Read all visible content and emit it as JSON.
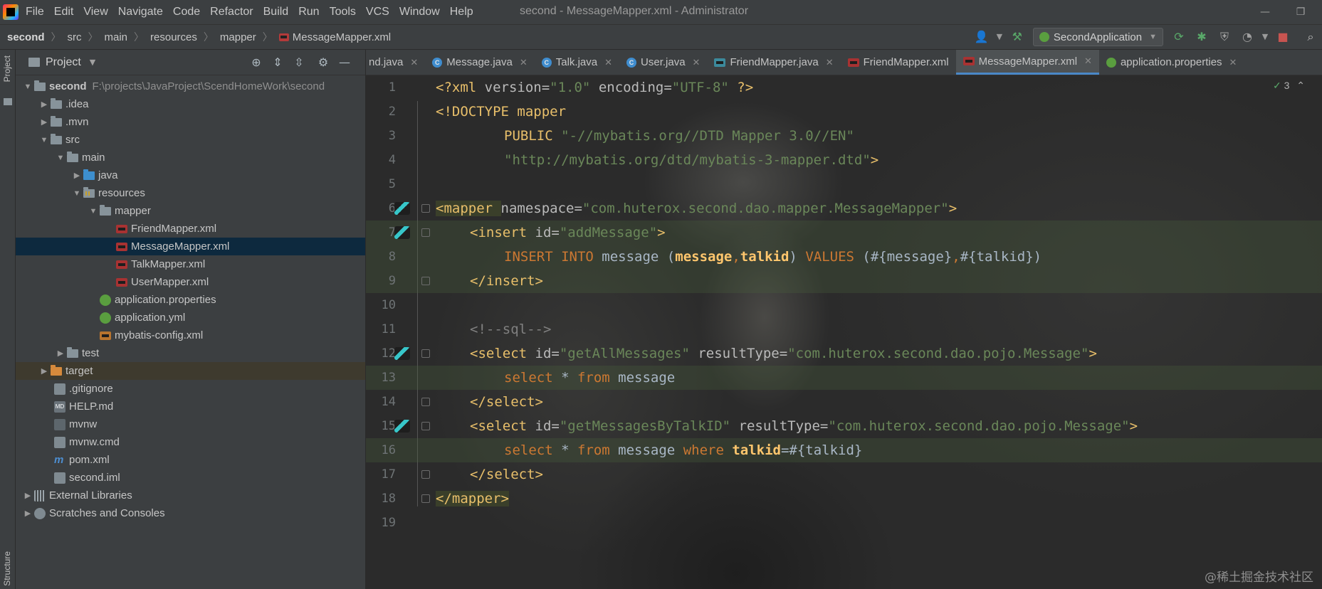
{
  "menu": [
    "File",
    "Edit",
    "View",
    "Navigate",
    "Code",
    "Refactor",
    "Build",
    "Run",
    "Tools",
    "VCS",
    "Window",
    "Help"
  ],
  "window_title": "second - MessageMapper.xml - Administrator",
  "breadcrumb": [
    "second",
    "src",
    "main",
    "resources",
    "mapper",
    "MessageMapper.xml"
  ],
  "run_config": "SecondApplication",
  "left_strip": {
    "project": "Project",
    "structure": "Structure"
  },
  "project_panel": {
    "title": "Project",
    "tree": [
      {
        "label": "second",
        "path": "F:\\projects\\JavaProject\\ScendHomeWork\\second"
      },
      {
        "label": ".idea"
      },
      {
        "label": ".mvn"
      },
      {
        "label": "src"
      },
      {
        "label": "main"
      },
      {
        "label": "java"
      },
      {
        "label": "resources"
      },
      {
        "label": "mapper"
      },
      {
        "label": "FriendMapper.xml"
      },
      {
        "label": "MessageMapper.xml"
      },
      {
        "label": "TalkMapper.xml"
      },
      {
        "label": "UserMapper.xml"
      },
      {
        "label": "application.properties"
      },
      {
        "label": "application.yml"
      },
      {
        "label": "mybatis-config.xml"
      },
      {
        "label": "test"
      },
      {
        "label": "target"
      },
      {
        "label": ".gitignore"
      },
      {
        "label": "HELP.md"
      },
      {
        "label": "mvnw"
      },
      {
        "label": "mvnw.cmd"
      },
      {
        "label": "pom.xml"
      },
      {
        "label": "second.iml"
      },
      {
        "label": "External Libraries"
      },
      {
        "label": "Scratches and Consoles"
      }
    ]
  },
  "tabs": [
    {
      "label": "nd.java"
    },
    {
      "label": "Message.java"
    },
    {
      "label": "Talk.java"
    },
    {
      "label": "User.java"
    },
    {
      "label": "FriendMapper.java"
    },
    {
      "label": "FriendMapper.xml"
    },
    {
      "label": "MessageMapper.xml"
    },
    {
      "label": "application.properties"
    }
  ],
  "inspection_count": "3",
  "watermark": "@稀土掘金技术社区",
  "line_numbers": [
    "1",
    "2",
    "3",
    "4",
    "5",
    "6",
    "7",
    "8",
    "9",
    "10",
    "11",
    "12",
    "13",
    "14",
    "15",
    "16",
    "17",
    "18",
    "19"
  ],
  "code": {
    "l1": {
      "a": "<?xml ",
      "b": "version",
      "c": "=",
      "d": "\"1.0\"",
      "e": " encoding",
      "f": "=",
      "g": "\"UTF-8\"",
      "h": " ?>"
    },
    "l2": {
      "a": "<!DOCTYPE mapper"
    },
    "l3": {
      "a": "PUBLIC ",
      "b": "\"-//mybatis.org//DTD Mapper 3.0//EN\""
    },
    "l4": {
      "a": "\"http://mybatis.org/dtd/mybatis-3-mapper.dtd\"",
      "b": ">"
    },
    "l6": {
      "a": "<mapper ",
      "b": "namespace",
      "c": "=",
      "d": "\"com.huterox.second.dao.mapper.MessageMapper\"",
      "e": ">"
    },
    "l7": {
      "a": "<insert ",
      "b": "id",
      "c": "=",
      "d": "\"addMessage\"",
      "e": ">"
    },
    "l8": {
      "a": "INSERT INTO ",
      "b": "message ",
      "c": "(",
      "d": "message",
      "e": ",",
      "f": "talkid",
      "g": ") ",
      "h": "VALUES ",
      "i": "(#{message}",
      "j": ",",
      "k": "#{talkid})"
    },
    "l9": {
      "a": "</insert>"
    },
    "l11": {
      "a": "<!--sql-->"
    },
    "l12": {
      "a": "<select ",
      "b": "id",
      "c": "=",
      "d": "\"getAllMessages\"",
      "e": " resultType",
      "f": "=",
      "g": "\"com.huterox.second.dao.pojo.Message\"",
      "h": ">"
    },
    "l13": {
      "a": "select ",
      "b": "* ",
      "c": "from ",
      "d": "message"
    },
    "l14": {
      "a": "</select>"
    },
    "l15": {
      "a": "<select ",
      "b": "id",
      "c": "=",
      "d": "\"getMessagesByTalkID\"",
      "e": " resultType",
      "f": "=",
      "g": "\"com.huterox.second.dao.pojo.Message\"",
      "h": ">"
    },
    "l16": {
      "a": "select ",
      "b": "* ",
      "c": "from ",
      "d": "message ",
      "e": "where ",
      "f": "talkid",
      "g": "=#{talkid}"
    },
    "l17": {
      "a": "</select>"
    },
    "l18": {
      "a": "</mapper>"
    }
  }
}
